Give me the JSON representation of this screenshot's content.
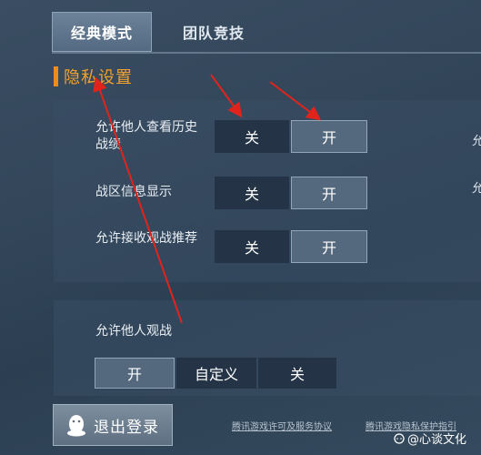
{
  "tabs": [
    {
      "label": "经典模式",
      "active": true
    },
    {
      "label": "团队竞技",
      "active": false
    }
  ],
  "section": {
    "title": "隐私设置"
  },
  "privacy_rows": [
    {
      "label": "允许他人查看历史战绩",
      "off_label": "关",
      "on_label": "开",
      "selected": "开"
    },
    {
      "label": "战区信息显示",
      "off_label": "关",
      "on_label": "开",
      "selected": "开"
    },
    {
      "label": "允许接收观战推荐",
      "off_label": "关",
      "on_label": "开",
      "selected": "开"
    }
  ],
  "spectate": {
    "label": "允许他人观战",
    "options": [
      "开",
      "自定义",
      "关"
    ],
    "selected": "开"
  },
  "cut_text": {
    "right_1": "允",
    "right_2": "允"
  },
  "logout": {
    "label": "退出登录"
  },
  "footer": {
    "license_link": "腾讯游戏许可及服务协议",
    "privacy_link": "腾讯游戏隐私保护指引"
  },
  "watermark": {
    "text": "@心谈文化"
  },
  "colors": {
    "accent": "#f3a12d",
    "annotation": "#e0241b",
    "selected_bg": "#55697e",
    "unselected_bg": "#243446"
  }
}
